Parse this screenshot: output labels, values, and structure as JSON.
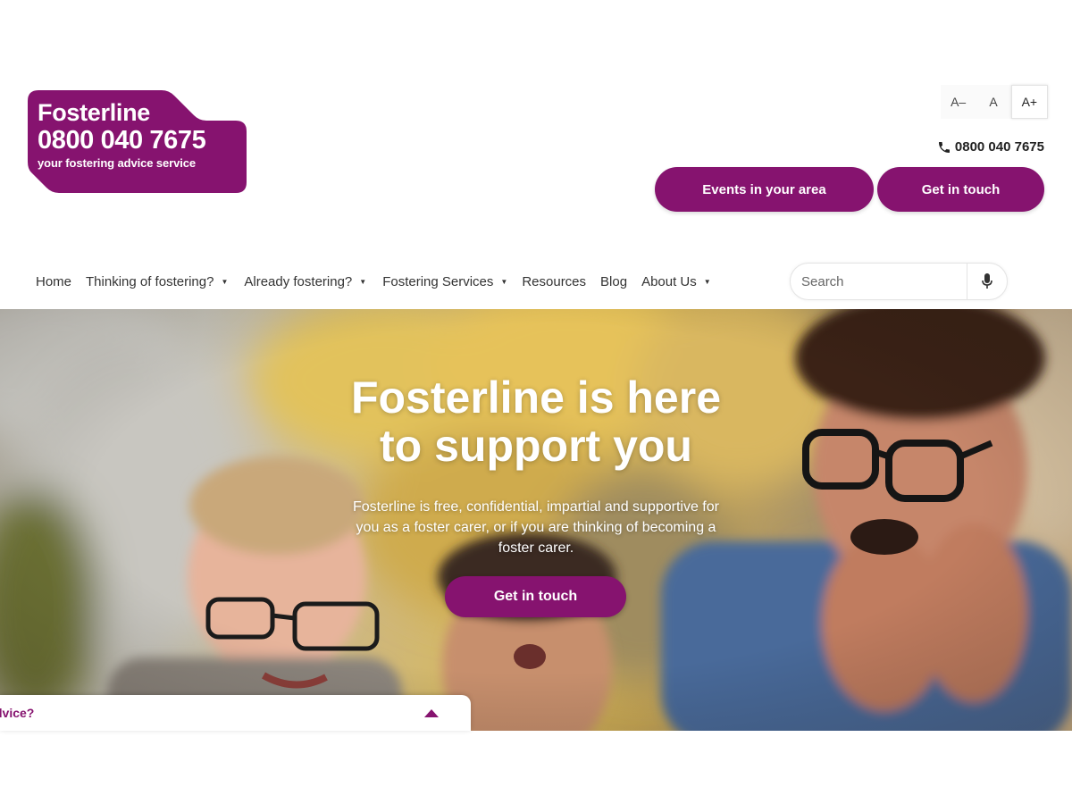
{
  "logo": {
    "name": "Fosterline",
    "phone": "0800 040 7675",
    "tagline": "your fostering advice service"
  },
  "font_controls": {
    "decrease": "A–",
    "normal": "A",
    "increase": "A+"
  },
  "header": {
    "phone": "0800 040 7675",
    "events_button": "Events in your area",
    "contact_button": "Get in touch"
  },
  "nav": {
    "items": [
      {
        "label": "Home",
        "dropdown": false
      },
      {
        "label": "Thinking of fostering?",
        "dropdown": true
      },
      {
        "label": "Already fostering?",
        "dropdown": true
      },
      {
        "label": "Fostering Services",
        "dropdown": true
      },
      {
        "label": "Resources",
        "dropdown": false
      },
      {
        "label": "Blog",
        "dropdown": false
      },
      {
        "label": "About Us",
        "dropdown": true
      }
    ],
    "search_placeholder": "Search"
  },
  "hero": {
    "title_line1": "Fosterline is here",
    "title_line2": "to support you",
    "text": "Fosterline is free, confidential, impartial and supportive for you as a foster carer, or if you are thinking of becoming a foster carer.",
    "button": "Get in touch"
  },
  "chat": {
    "label": "dvice?"
  },
  "colors": {
    "brand_purple": "#86136f",
    "text_dark": "#333333"
  },
  "icons": {
    "phone": "phone-icon",
    "mic": "microphone-icon",
    "dropdown": "caret-down-icon",
    "chat_toggle": "caret-up-icon"
  }
}
